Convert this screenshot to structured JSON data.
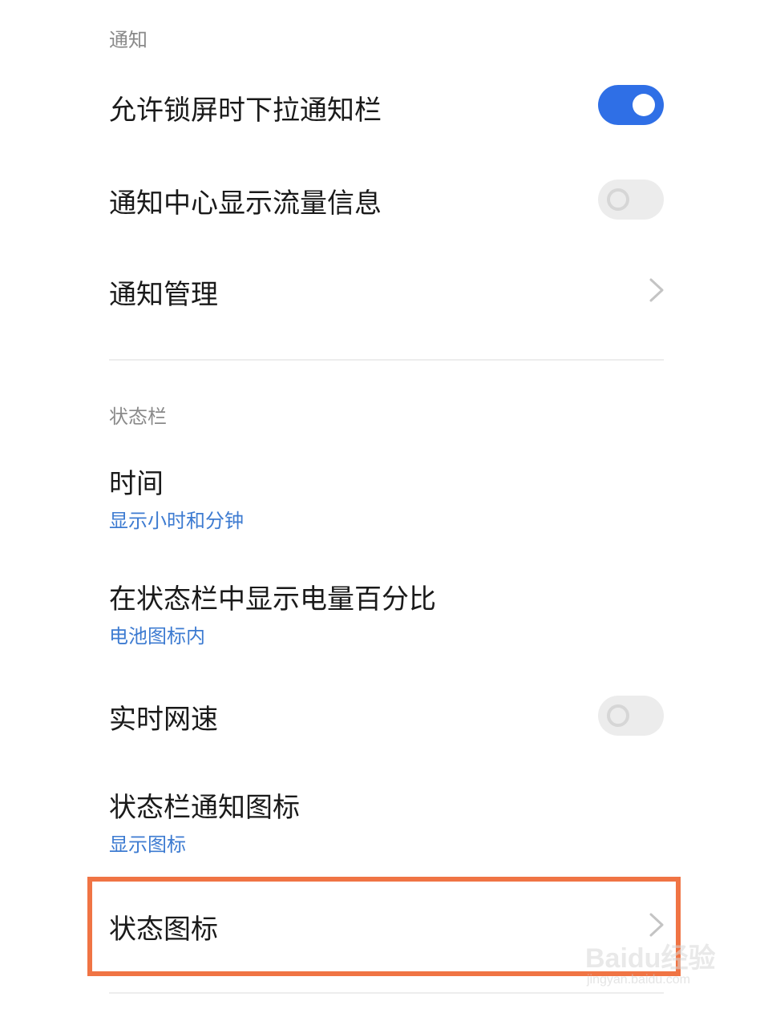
{
  "notifications_section": {
    "header": "通知",
    "items": [
      {
        "title": "允许锁屏时下拉通知栏",
        "control": "toggle",
        "state": "on"
      },
      {
        "title": "通知中心显示流量信息",
        "control": "toggle",
        "state": "off"
      },
      {
        "title": "通知管理",
        "control": "chevron"
      }
    ]
  },
  "statusbar_section": {
    "header": "状态栏",
    "items": [
      {
        "title": "时间",
        "subtitle": "显示小时和分钟"
      },
      {
        "title": "在状态栏中显示电量百分比",
        "subtitle": "电池图标内"
      },
      {
        "title": "实时网速",
        "control": "toggle",
        "state": "off"
      },
      {
        "title": "状态栏通知图标",
        "subtitle": "显示图标"
      },
      {
        "title": "状态图标",
        "control": "chevron",
        "highlighted": true
      }
    ]
  },
  "colors": {
    "toggle_on": "#2f6fe6",
    "toggle_off": "#ececec",
    "subtitle": "#3d7bd1",
    "highlight_border": "#f07444",
    "section_header": "#8a8a8a"
  },
  "watermark": {
    "logo_text": "Baidu经验",
    "url": "jingyan.baidu.com"
  }
}
